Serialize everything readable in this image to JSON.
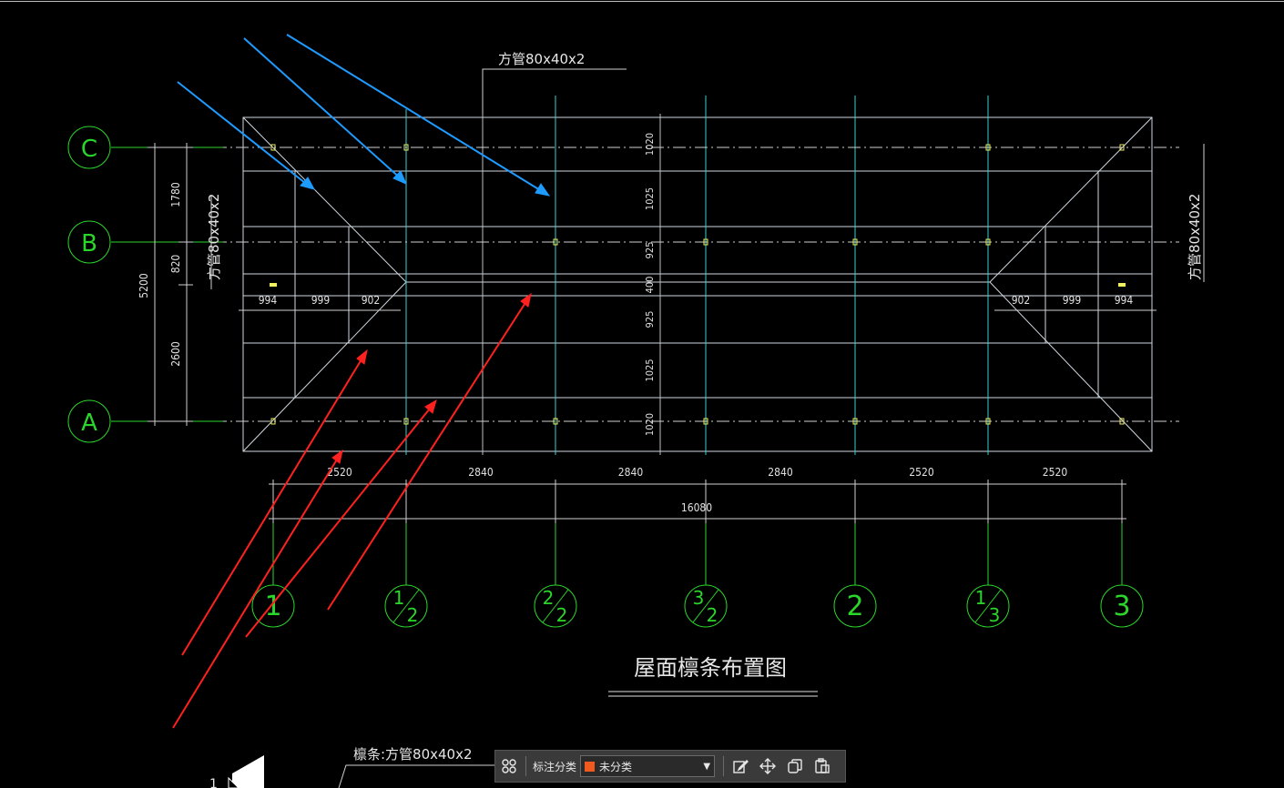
{
  "drawing": {
    "title": "屋面檩条布置图",
    "callout_top": "方管80x40x2",
    "callout_left": "方管80x40x2",
    "callout_right": "方管80x40x2",
    "callout_bottom": "檩条:方管80x40x2",
    "axes_rows": [
      "C",
      "B",
      "A"
    ],
    "axes_cols": [
      {
        "num": "1",
        "den": ""
      },
      {
        "num": "1",
        "den": "2"
      },
      {
        "num": "2",
        "den": "2"
      },
      {
        "num": "3",
        "den": "2"
      },
      {
        "num": "2",
        "den": ""
      },
      {
        "num": "1",
        "den": "3"
      },
      {
        "num": "3",
        "den": ""
      }
    ],
    "dims_bottom": [
      "2520",
      "2840",
      "2840",
      "2840",
      "2520",
      "2520"
    ],
    "dim_total": "16080",
    "dims_left": [
      "1780",
      "820",
      "2600"
    ],
    "dim_left_total": "5200",
    "dims_vertical_mid": [
      "1020",
      "1025",
      "925",
      "400",
      "925",
      "1025",
      "1020"
    ],
    "dims_hip_left": [
      "994",
      "999",
      "902"
    ],
    "dims_hip_right": [
      "902",
      "999",
      "994"
    ],
    "marker_small": "1",
    "colors": {
      "axis": "#2bd62b",
      "purlin": "#38d0d0",
      "outline": "#cfd8e0",
      "arrow_blue": "#1e9bff",
      "arrow_red": "#ff2020",
      "marker": "#f0f060"
    }
  },
  "toolbar": {
    "label": "标注分类",
    "selected": "未分类",
    "icons": [
      "grid-icon",
      "edit-icon",
      "move-icon",
      "copy-icon",
      "paste-icon"
    ]
  }
}
